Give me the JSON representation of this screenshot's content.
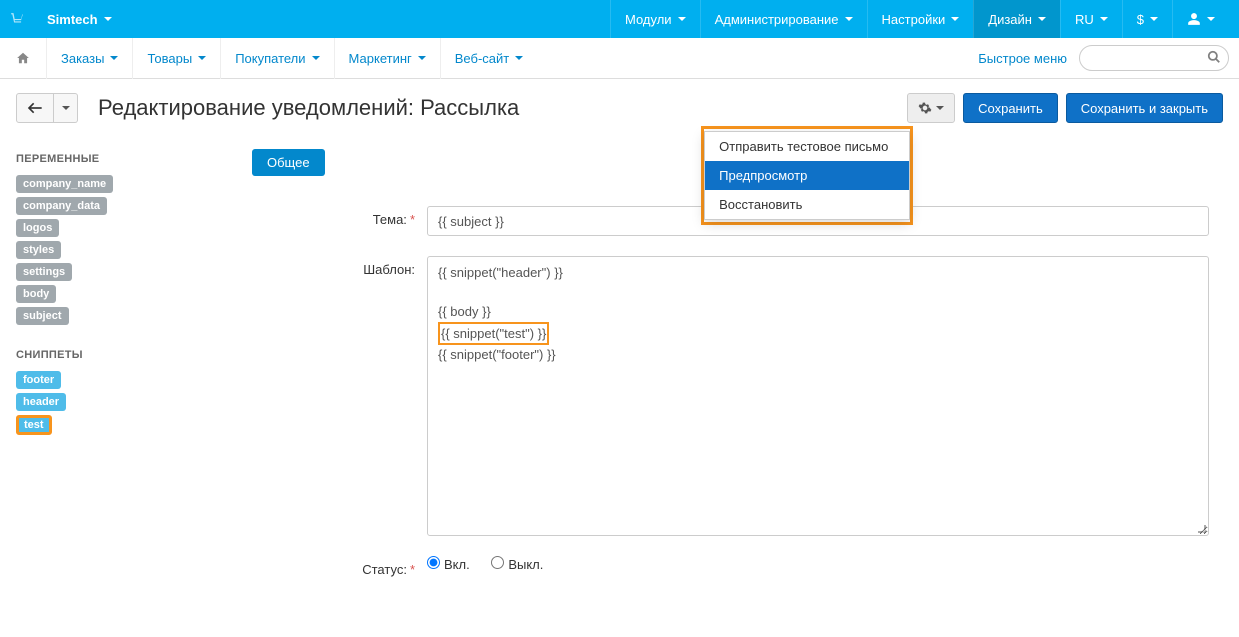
{
  "topNav": {
    "brand": "Simtech",
    "items": [
      "Модули",
      "Администрирование",
      "Настройки",
      "Дизайн",
      "RU",
      "$"
    ]
  },
  "subNav": {
    "items": [
      "Заказы",
      "Товары",
      "Покупатели",
      "Маркетинг",
      "Веб-сайт"
    ],
    "quickMenu": "Быстрое меню"
  },
  "page": {
    "title": "Редактирование уведомлений: Рассылка",
    "saveBtn": "Сохранить",
    "saveCloseBtn": "Сохранить и закрыть"
  },
  "dropdown": {
    "items": [
      "Отправить тестовое письмо",
      "Предпросмотр",
      "Восстановить"
    ],
    "highlightedIndex": 1
  },
  "sidebar": {
    "varsTitle": "ПЕРЕМЕННЫЕ",
    "vars": [
      "company_name",
      "company_data",
      "logos",
      "styles",
      "settings",
      "body",
      "subject"
    ],
    "snippetsTitle": "СНИППЕТЫ",
    "snippets": [
      "footer",
      "header",
      "test"
    ],
    "highlightedSnippet": "test"
  },
  "form": {
    "tab": "Общее",
    "subjectLabel": "Тема:",
    "subjectValue": "{{ subject }}",
    "templateLabel": "Шаблон:",
    "templateLines": {
      "l1": "{{ snippet(\"header\") }}",
      "l2": "",
      "l3": "{{ body }}",
      "l4": "{{ snippet(\"test\") }}",
      "l5": "{{ snippet(\"footer\") }}"
    },
    "statusLabel": "Статус:",
    "statusOn": "Вкл.",
    "statusOff": "Выкл."
  }
}
